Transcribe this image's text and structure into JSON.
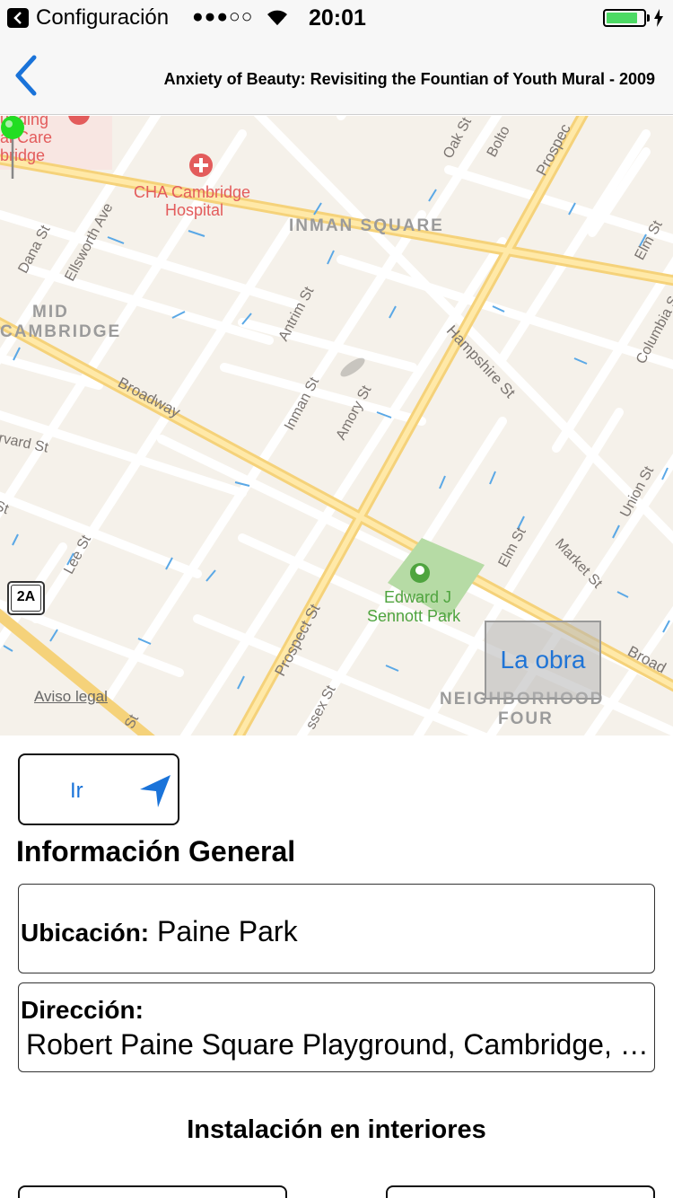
{
  "status_bar": {
    "back_app": "Configuración",
    "signal": "●●●○○",
    "time": "20:01",
    "battery_level": 0.85,
    "battery_color": "#4cd964"
  },
  "nav": {
    "back_icon": "chevron-left-icon",
    "title": "Anxiety of Beauty: Revisiting the Fountian of Youth Mural - 2009",
    "accent": "#1a73d9"
  },
  "map": {
    "areas": {
      "inman_square": "INMAN SQUARE",
      "mid_cambridge_1": "MID",
      "mid_cambridge_2": "CAMBRIDGE",
      "neighborhood_1": "NEIGHBORHOOD",
      "neighborhood_2": "FOUR"
    },
    "pois": {
      "hospital_1": "CHA Cambridge",
      "hospital_2": "Hospital",
      "care_1": "al Care",
      "care_2": "bridge",
      "care_0": "unding",
      "park_1": "Edward J",
      "park_2": "Sennott Park"
    },
    "streets": {
      "dana": "Dana St",
      "ellsworth": "Ellsworth Ave",
      "broadway": "Broadway",
      "broadway_right": "Broad",
      "harvard": "rvard St",
      "antrim": "Antrim St",
      "inman": "Inman St",
      "amory": "Amory St",
      "hampshire": "Hampshire St",
      "prospect_top": "Prospec",
      "prospect_bottom": "Prospect St",
      "oak": "Oak St",
      "bolton": "Bolto",
      "elm_top": "Elm St",
      "elm_mid": "Elm St",
      "columbia": "Columbia S",
      "union": "Union St",
      "market": "Market St",
      "lee": "Lee St",
      "essex": "ssex St",
      "st_left": "St",
      "st_bottom": "St"
    },
    "route_shield": "2A",
    "legal": "Aviso legal",
    "overlay_label": "La obra",
    "pin_color": "#22dd22"
  },
  "go_button": {
    "label": "Ir",
    "icon": "location-arrow-icon"
  },
  "general_info": {
    "title": "Información General",
    "location_key": "Ubicación:",
    "location_value": "Paine Park",
    "address_key": "Dirección:",
    "address_value": "Robert Paine Square Playground, Cambridge, MA"
  },
  "indoor": {
    "title": "Instalación en interiores"
  }
}
